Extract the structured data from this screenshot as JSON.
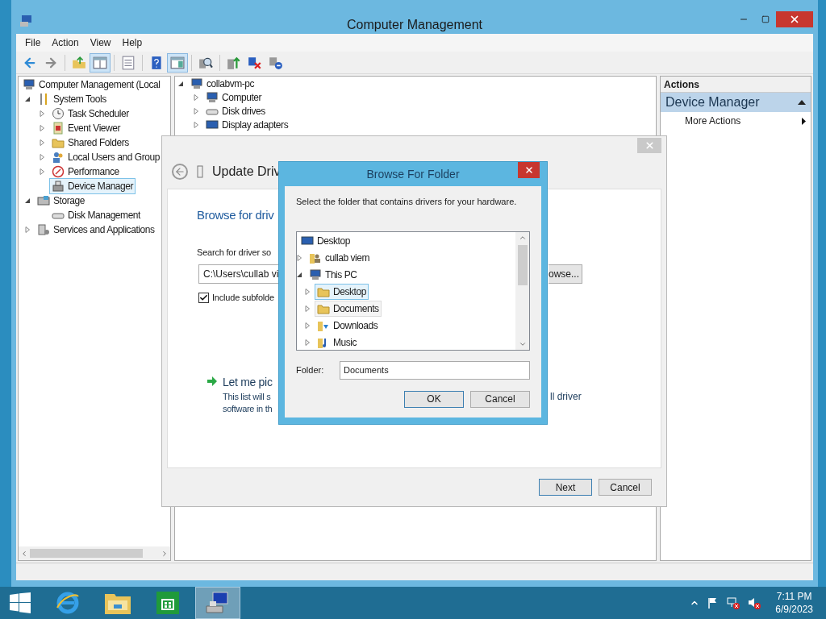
{
  "window": {
    "title": "Computer Management"
  },
  "menu": [
    "File",
    "Action",
    "View",
    "Help"
  ],
  "toolbar": [
    {
      "kind": "back",
      "pressed": false
    },
    {
      "kind": "forward",
      "pressed": false
    },
    {
      "kind": "sep"
    },
    {
      "kind": "up",
      "pressed": false
    },
    {
      "kind": "tree",
      "pressed": true
    },
    {
      "kind": "sep"
    },
    {
      "kind": "list",
      "pressed": false
    },
    {
      "kind": "sep"
    },
    {
      "kind": "help",
      "pressed": false
    },
    {
      "kind": "pane",
      "pressed": true
    },
    {
      "kind": "sep"
    },
    {
      "kind": "scan",
      "pressed": false
    },
    {
      "kind": "sep"
    },
    {
      "kind": "update",
      "pressed": false
    },
    {
      "kind": "remove",
      "pressed": false
    },
    {
      "kind": "disable",
      "pressed": false
    }
  ],
  "console_tree": [
    {
      "label": "Computer Management (Local",
      "selected": false,
      "children": [
        {
          "label": "System Tools",
          "expanded": true,
          "selected": false,
          "children": [
            {
              "label": "Task Scheduler",
              "expanded": false,
              "selected": false
            },
            {
              "label": "Event Viewer",
              "expanded": false,
              "selected": false
            },
            {
              "label": "Shared Folders",
              "expanded": false,
              "selected": false
            },
            {
              "label": "Local Users and Group",
              "expanded": false,
              "selected": false
            },
            {
              "label": "Performance",
              "expanded": false,
              "selected": false
            },
            {
              "label": "Device Manager",
              "selected": true
            }
          ]
        },
        {
          "label": "Storage",
          "expanded": true,
          "selected": false,
          "children": [
            {
              "label": "Disk Management",
              "selected": false
            }
          ]
        },
        {
          "label": "Services and Applications",
          "expanded": false,
          "selected": false
        }
      ]
    }
  ],
  "device_tree": [
    {
      "label": "collabvm-pc",
      "expanded": true,
      "selected": false,
      "children": [
        {
          "label": "Computer",
          "expanded": false,
          "selected": false
        },
        {
          "label": "Disk drives",
          "expanded": false,
          "selected": false
        },
        {
          "label": "Display adapters",
          "expanded": false,
          "selected": false
        }
      ]
    }
  ],
  "actions": {
    "title": "Actions",
    "section": "Device Manager",
    "items": [
      "More Actions"
    ]
  },
  "update_dialog": {
    "heading": "Update Driv",
    "subheading": "Browse for driv",
    "search_label": "Search for driver so",
    "path": "C:\\Users\\cullab vi",
    "browse_button": "owse...",
    "include_subfolders": {
      "label": "Include subfolde",
      "checked": true
    },
    "pick_link": "Let me pic",
    "pick_text": [
      "This list will s",
      "software in th"
    ],
    "pick_text_right": "ll driver",
    "buttons": [
      "Next",
      "Cancel"
    ]
  },
  "browse_dialog": {
    "title": "Browse For Folder",
    "instruction": "Select the folder that contains drivers for your hardware.",
    "tree": [
      {
        "label": "Desktop",
        "selected": false,
        "hover": false,
        "children": [
          {
            "label": "cullab viem",
            "expanded": false,
            "selected": false,
            "hover": false
          },
          {
            "label": "This PC",
            "expanded": true,
            "selected": false,
            "hover": false,
            "children": [
              {
                "label": "Desktop",
                "expanded": false,
                "selected": true,
                "hover": false
              },
              {
                "label": "Documents",
                "expanded": false,
                "selected": false,
                "hover": true
              },
              {
                "label": "Downloads",
                "expanded": false,
                "selected": false,
                "hover": false
              },
              {
                "label": "Music",
                "expanded": false,
                "selected": false,
                "hover": false
              }
            ]
          }
        ]
      }
    ],
    "folder_label": "Folder:",
    "folder": "Documents",
    "buttons": [
      "OK",
      "Cancel"
    ]
  },
  "taskbar": {
    "apps": [
      {
        "kind": "browser",
        "selected": false
      },
      {
        "kind": "files",
        "selected": false
      },
      {
        "kind": "store",
        "selected": false
      },
      {
        "kind": "management",
        "selected": true
      }
    ],
    "time": "7:11 PM",
    "date": "6/9/2023"
  }
}
